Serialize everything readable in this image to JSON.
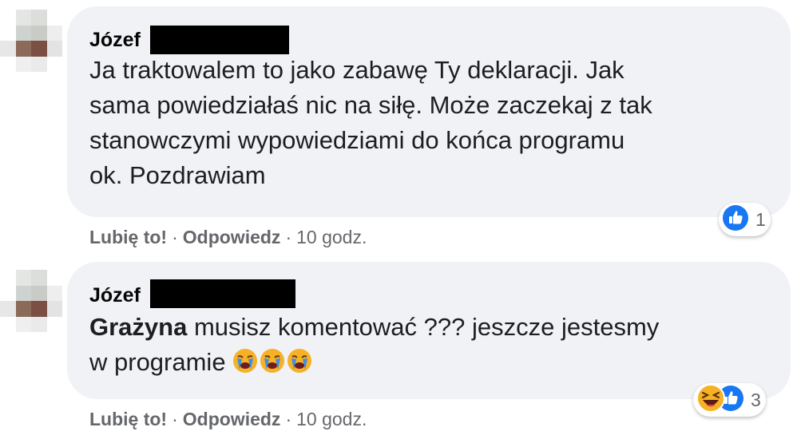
{
  "comments": [
    {
      "author": "Józef",
      "lines": [
        "Ja traktowalem to jako zabawę Ty deklaracji. Jak",
        "sama powiedziałaś nic na siłę. Może zaczekaj z tak",
        "stanowczymi wypowiedziami do końca programu",
        "ok. Pozdrawiam"
      ],
      "reactions": {
        "icons": [
          "like-icon"
        ],
        "count": "1"
      },
      "actions": {
        "like": "Lubię to!",
        "reply": "Odpowiedz",
        "separator": "·",
        "time": "10 godz."
      }
    },
    {
      "author": "Józef",
      "mention": "Grażyna",
      "line1_rest": " musisz komentować ??? jeszcze jestesmy",
      "line2": "w programie ",
      "emojis": [
        "crying-face-icon",
        "crying-face-icon",
        "crying-face-icon"
      ],
      "reactions": {
        "icons": [
          "haha-icon",
          "like-icon"
        ],
        "count": "3"
      },
      "actions": {
        "like": "Lubię to!",
        "reply": "Odpowiedz",
        "separator": "·",
        "time": "10 godz."
      }
    }
  ],
  "colors": {
    "bubble": "#f0f2f5",
    "like_blue": "#1877f2",
    "haha_yellow": "#f7b125",
    "meta_gray": "#65676b"
  }
}
